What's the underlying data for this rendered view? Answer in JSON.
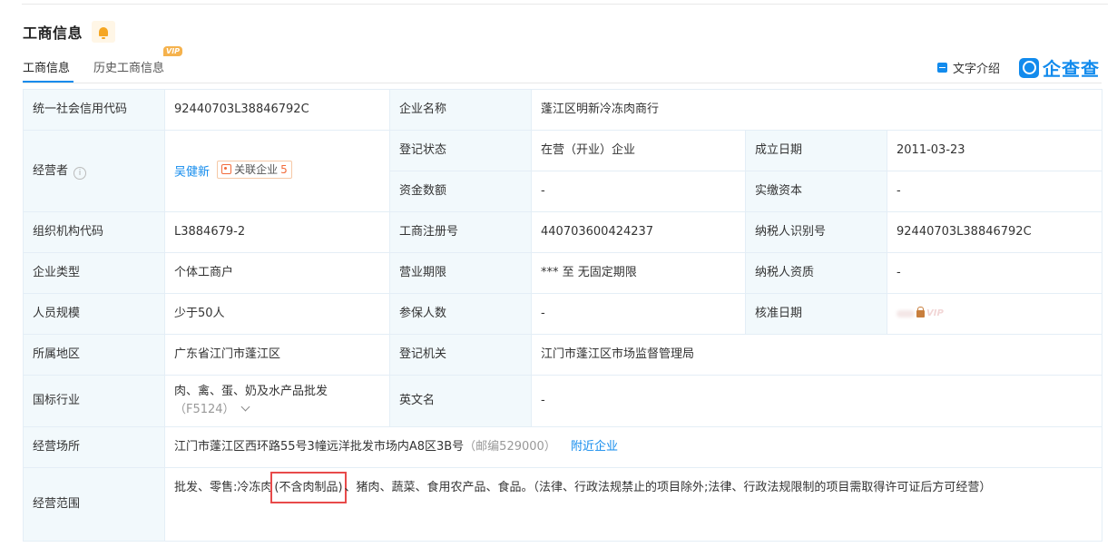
{
  "header": {
    "title": "工商信息",
    "tabs": [
      "工商信息",
      "历史工商信息"
    ],
    "vip_badge": "VIP",
    "text_intro": "文字介绍",
    "logo": "企查查"
  },
  "rows": {
    "credit_code": {
      "label": "统一社会信用代码",
      "value": "92440703L38846792C"
    },
    "company_name": {
      "label": "企业名称",
      "value": "蓬江区明新冷冻肉商行"
    },
    "operator": {
      "label": "经营者",
      "name": "吴健新",
      "related_label": "关联企业",
      "related_count": "5"
    },
    "reg_status": {
      "label": "登记状态",
      "value": "在营（开业）企业"
    },
    "founded": {
      "label": "成立日期",
      "value": "2011-03-23"
    },
    "capital": {
      "label": "资金数额",
      "value": "-"
    },
    "paid_capital": {
      "label": "实缴资本",
      "value": "-"
    },
    "org_code": {
      "label": "组织机构代码",
      "value": "L3884679-2"
    },
    "reg_no": {
      "label": "工商注册号",
      "value": "440703600424237"
    },
    "taxpayer_id": {
      "label": "纳税人识别号",
      "value": "92440703L38846792C"
    },
    "company_type": {
      "label": "企业类型",
      "value": "个体工商户"
    },
    "term": {
      "label": "营业期限",
      "value": "*** 至 无固定期限"
    },
    "taxpayer_qual": {
      "label": "纳税人资质",
      "value": "-"
    },
    "staff_size": {
      "label": "人员规模",
      "value": "少于50人"
    },
    "insured": {
      "label": "参保人数",
      "value": "-"
    },
    "approval_date": {
      "label": "核准日期",
      "locked_badge": "VIP"
    },
    "region": {
      "label": "所属地区",
      "value": "广东省江门市蓬江区"
    },
    "authority": {
      "label": "登记机关",
      "value": "江门市蓬江区市场监督管理局"
    },
    "industry": {
      "label": "国标行业",
      "value": "肉、禽、蛋、奶及水产品批发",
      "code": "（F5124）"
    },
    "english_name": {
      "label": "英文名",
      "value": "-"
    },
    "address": {
      "label": "经营场所",
      "value": "江门市蓬江区西环路55号3幢远洋批发市场内A8区3B号",
      "postcode": "（邮编529000）",
      "nearby": "附近企业"
    },
    "scope": {
      "label": "经营范围",
      "prefix": "批发、零售:冷冻肉",
      "highlight": "(不含肉制品)",
      "suffix": "、猪肉、蔬菜、食用农产品、食品。（法律、行政法规禁止的项目除外;法律、行政法规限制的项目需取得许可证后方可经营）"
    }
  }
}
